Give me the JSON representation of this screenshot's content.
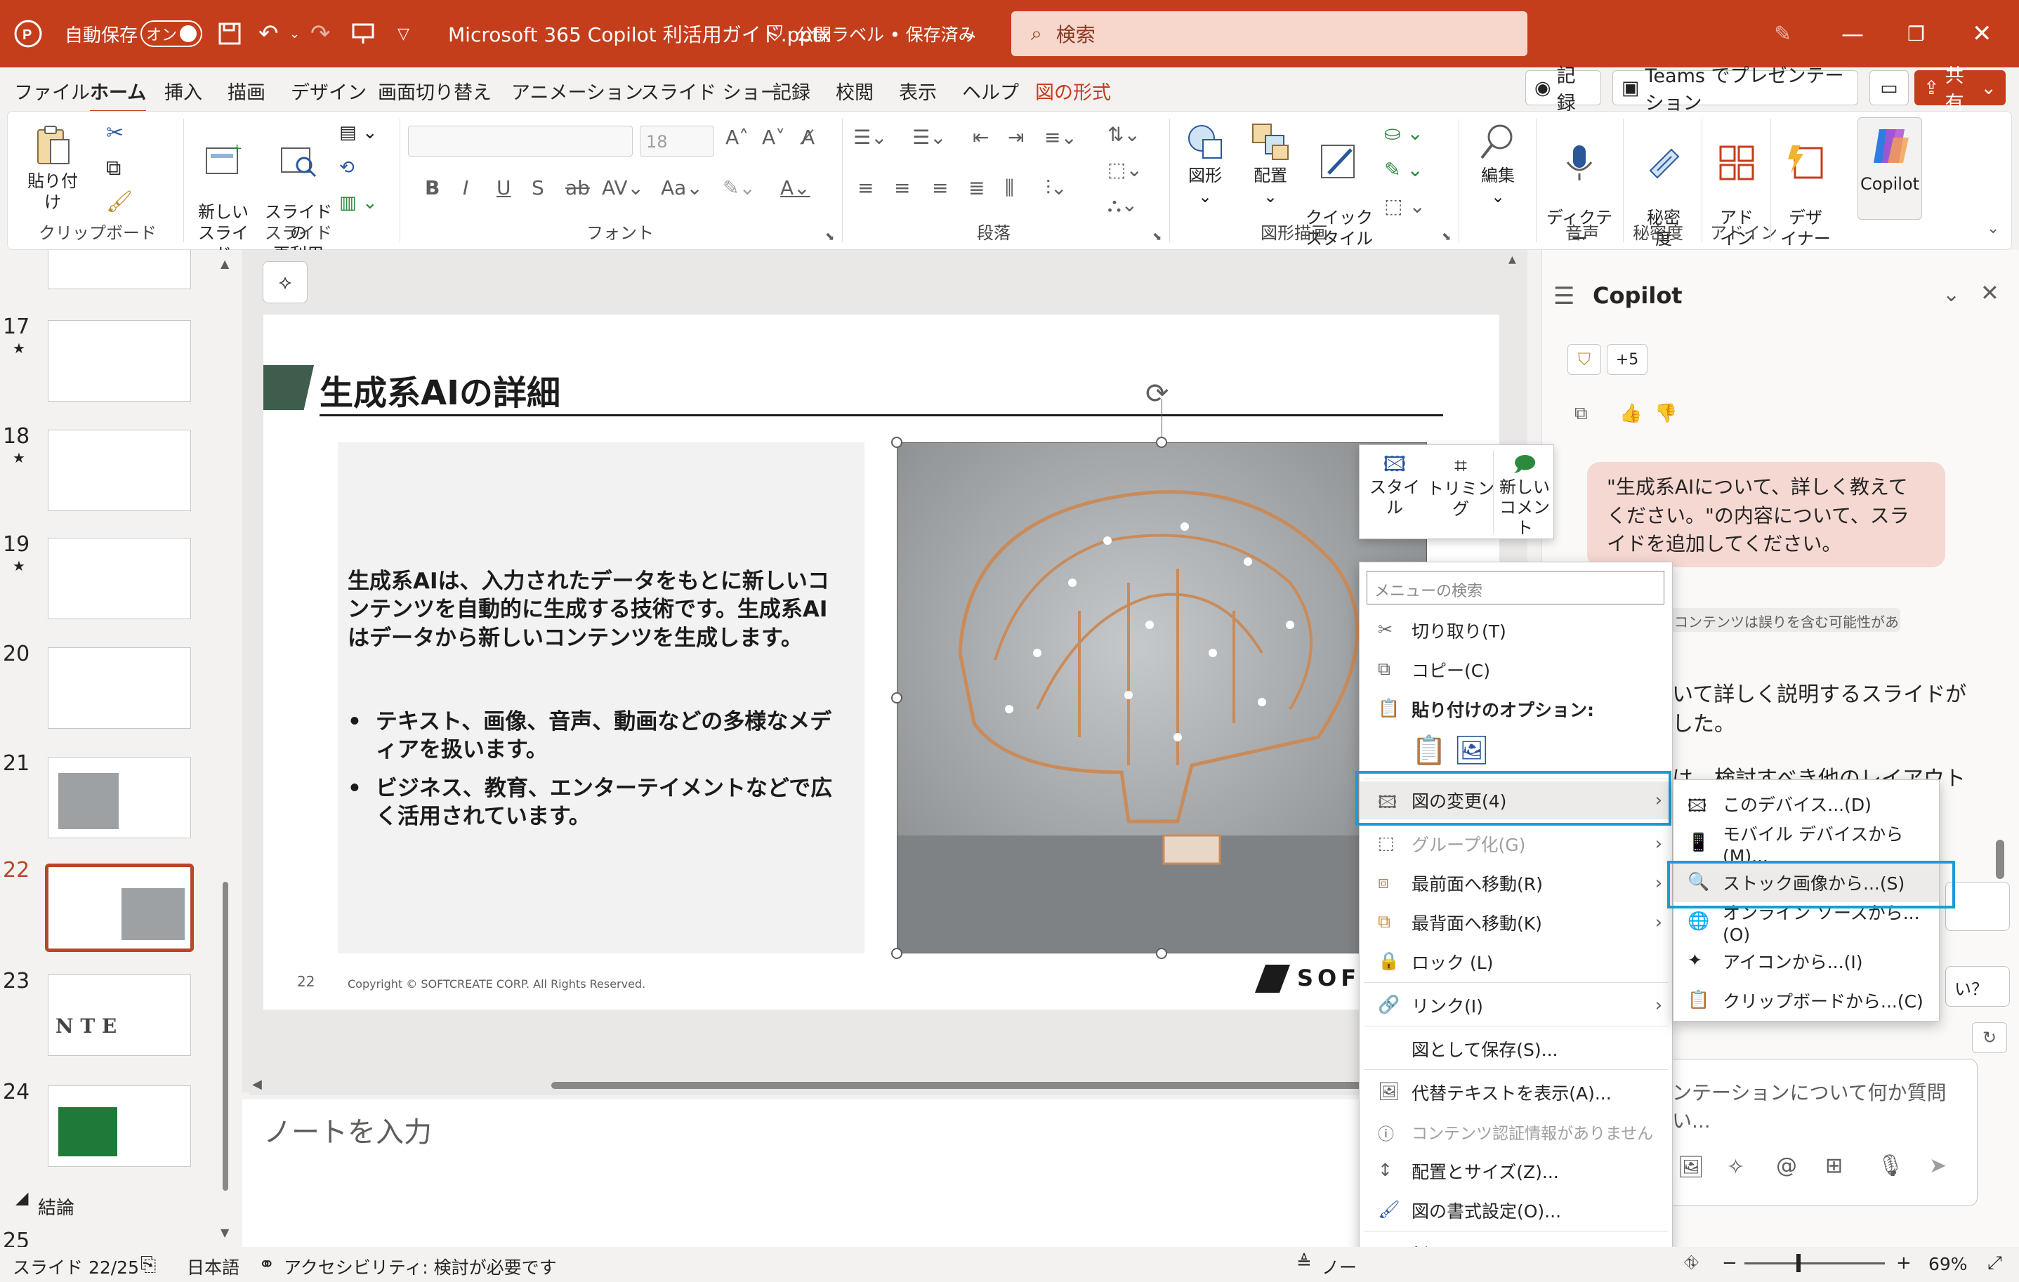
{
  "titlebar": {
    "autosave_label": "自動保存",
    "autosave_state": "オン",
    "doc_title": "Microsoft 365 Copilot 利活用ガイド.pptx",
    "label_status": "公開ラベル • 保存済み",
    "search_placeholder": "検索"
  },
  "menu": [
    "ファイル",
    "ホーム",
    "挿入",
    "描画",
    "デザイン",
    "画面切り替え",
    "アニメーション",
    "スライド ショー",
    "記録",
    "校閲",
    "表示",
    "ヘルプ",
    "図の形式"
  ],
  "top_buttons": {
    "record": "記録",
    "teams": "Teams でプレゼンテーション",
    "share": "共有"
  },
  "ribbon": {
    "clipboard": {
      "paste": "貼り付け",
      "label": "クリップボード"
    },
    "slides": {
      "new_slide": "新しい\nスライド",
      "reuse": "スライドの\n再利用",
      "label": "スライド"
    },
    "font": {
      "size": "18",
      "label": "フォント"
    },
    "paragraph": {
      "label": "段落"
    },
    "drawing": {
      "shapes": "図形",
      "arrange": "配置",
      "quick_styles": "クイック\nスタイル",
      "label": "図形描画"
    },
    "editing": {
      "edit": "編集"
    },
    "voice": {
      "dictate": "ディクテー\nション",
      "label": "音声"
    },
    "sensitivity": {
      "btn": "秘密\n度",
      "label": "秘密度"
    },
    "addins": {
      "btn": "アド\nイン",
      "label": "アドイン"
    },
    "designer": {
      "btn": "デザ\nイナー"
    },
    "copilot": {
      "btn": "Copilot"
    }
  },
  "thumbnails": [
    {
      "num": "17",
      "star": "★"
    },
    {
      "num": "18",
      "star": "★"
    },
    {
      "num": "19",
      "star": "★"
    },
    {
      "num": "20",
      "star": ""
    },
    {
      "num": "21",
      "star": ""
    },
    {
      "num": "22",
      "star": ""
    },
    {
      "num": "23",
      "star": ""
    },
    {
      "num": "24",
      "star": ""
    }
  ],
  "section_label": "結論",
  "last_num": "25",
  "slide": {
    "title": "生成系AIの詳細",
    "body": "生成系AIは、入力されたデータをもとに新しいコンテンツを自動的に生成する技術です。生成系AIはデータから新しいコンテンツを生成します。",
    "bullets": [
      "テキスト、画像、音声、動画などの多様なメディアを扱います。",
      "ビジネス、教育、エンターテイメントなどで広く活用されています。"
    ],
    "page_num": "22",
    "copyright": "Copyright © SOFTCREATE CORP. All Rights Reserved.",
    "logo_text": "SOF"
  },
  "notes_placeholder": "ノートを入力",
  "mini_toolbar": {
    "style": "スタイ\nル",
    "crop": "トリミング",
    "comment": "新しい\nコメント"
  },
  "context_menu": {
    "search_placeholder": "メニューの検索",
    "items": {
      "cut": "切り取り(T)",
      "copy": "コピー(C)",
      "paste_options": "貼り付けのオプション:",
      "change_picture": "図の変更(4)",
      "group": "グループ化(G)",
      "bring_front": "最前面へ移動(R)",
      "send_back": "最背面へ移動(K)",
      "lock": "ロック (L)",
      "link": "リンク(I)",
      "save_as_picture": "図として保存(S)...",
      "alt_text": "代替テキストを表示(A)...",
      "content_cred": "コンテンツ認証情報がありません",
      "size_position": "配置とサイズ(Z)...",
      "format_picture": "図の書式設定(O)...",
      "new_comment": "新しいコメント(M)"
    }
  },
  "submenu": {
    "this_device": "このデバイス...(D)",
    "mobile": "モバイル デバイスから(M)...",
    "stock": "ストック画像から...(S)",
    "online": "オンライン ソースから...(O)",
    "icons": "アイコンから...(I)",
    "clipboard": "クリップボードから...(C)"
  },
  "copilot": {
    "title": "Copilot",
    "badge": "+5",
    "user_msg": "\"生成系AIについて、詳しく教えてください。\"の内容について、スライドを追加してください。",
    "disclaimer": "コンテンツは誤りを含む可能性があります。",
    "reply_1": "いて詳しく説明するスライドが",
    "reply_2": "した。",
    "reply_3": "は、検討すべき他のレイアウト",
    "q_mark": "い？",
    "input_placeholder_1": "ンテーションについて何か質問",
    "input_placeholder_2": "い..."
  },
  "status": {
    "slide_pos": "スライド 22/25",
    "lang": "日本語",
    "accessibility": "アクセシビリティ: 検討が必要です",
    "notes": "ノート",
    "zoom": "69%"
  },
  "colors": {
    "brand": "#c43e1c",
    "highlight": "#1a9bd7",
    "slide_accent": "#3f5d4d"
  }
}
